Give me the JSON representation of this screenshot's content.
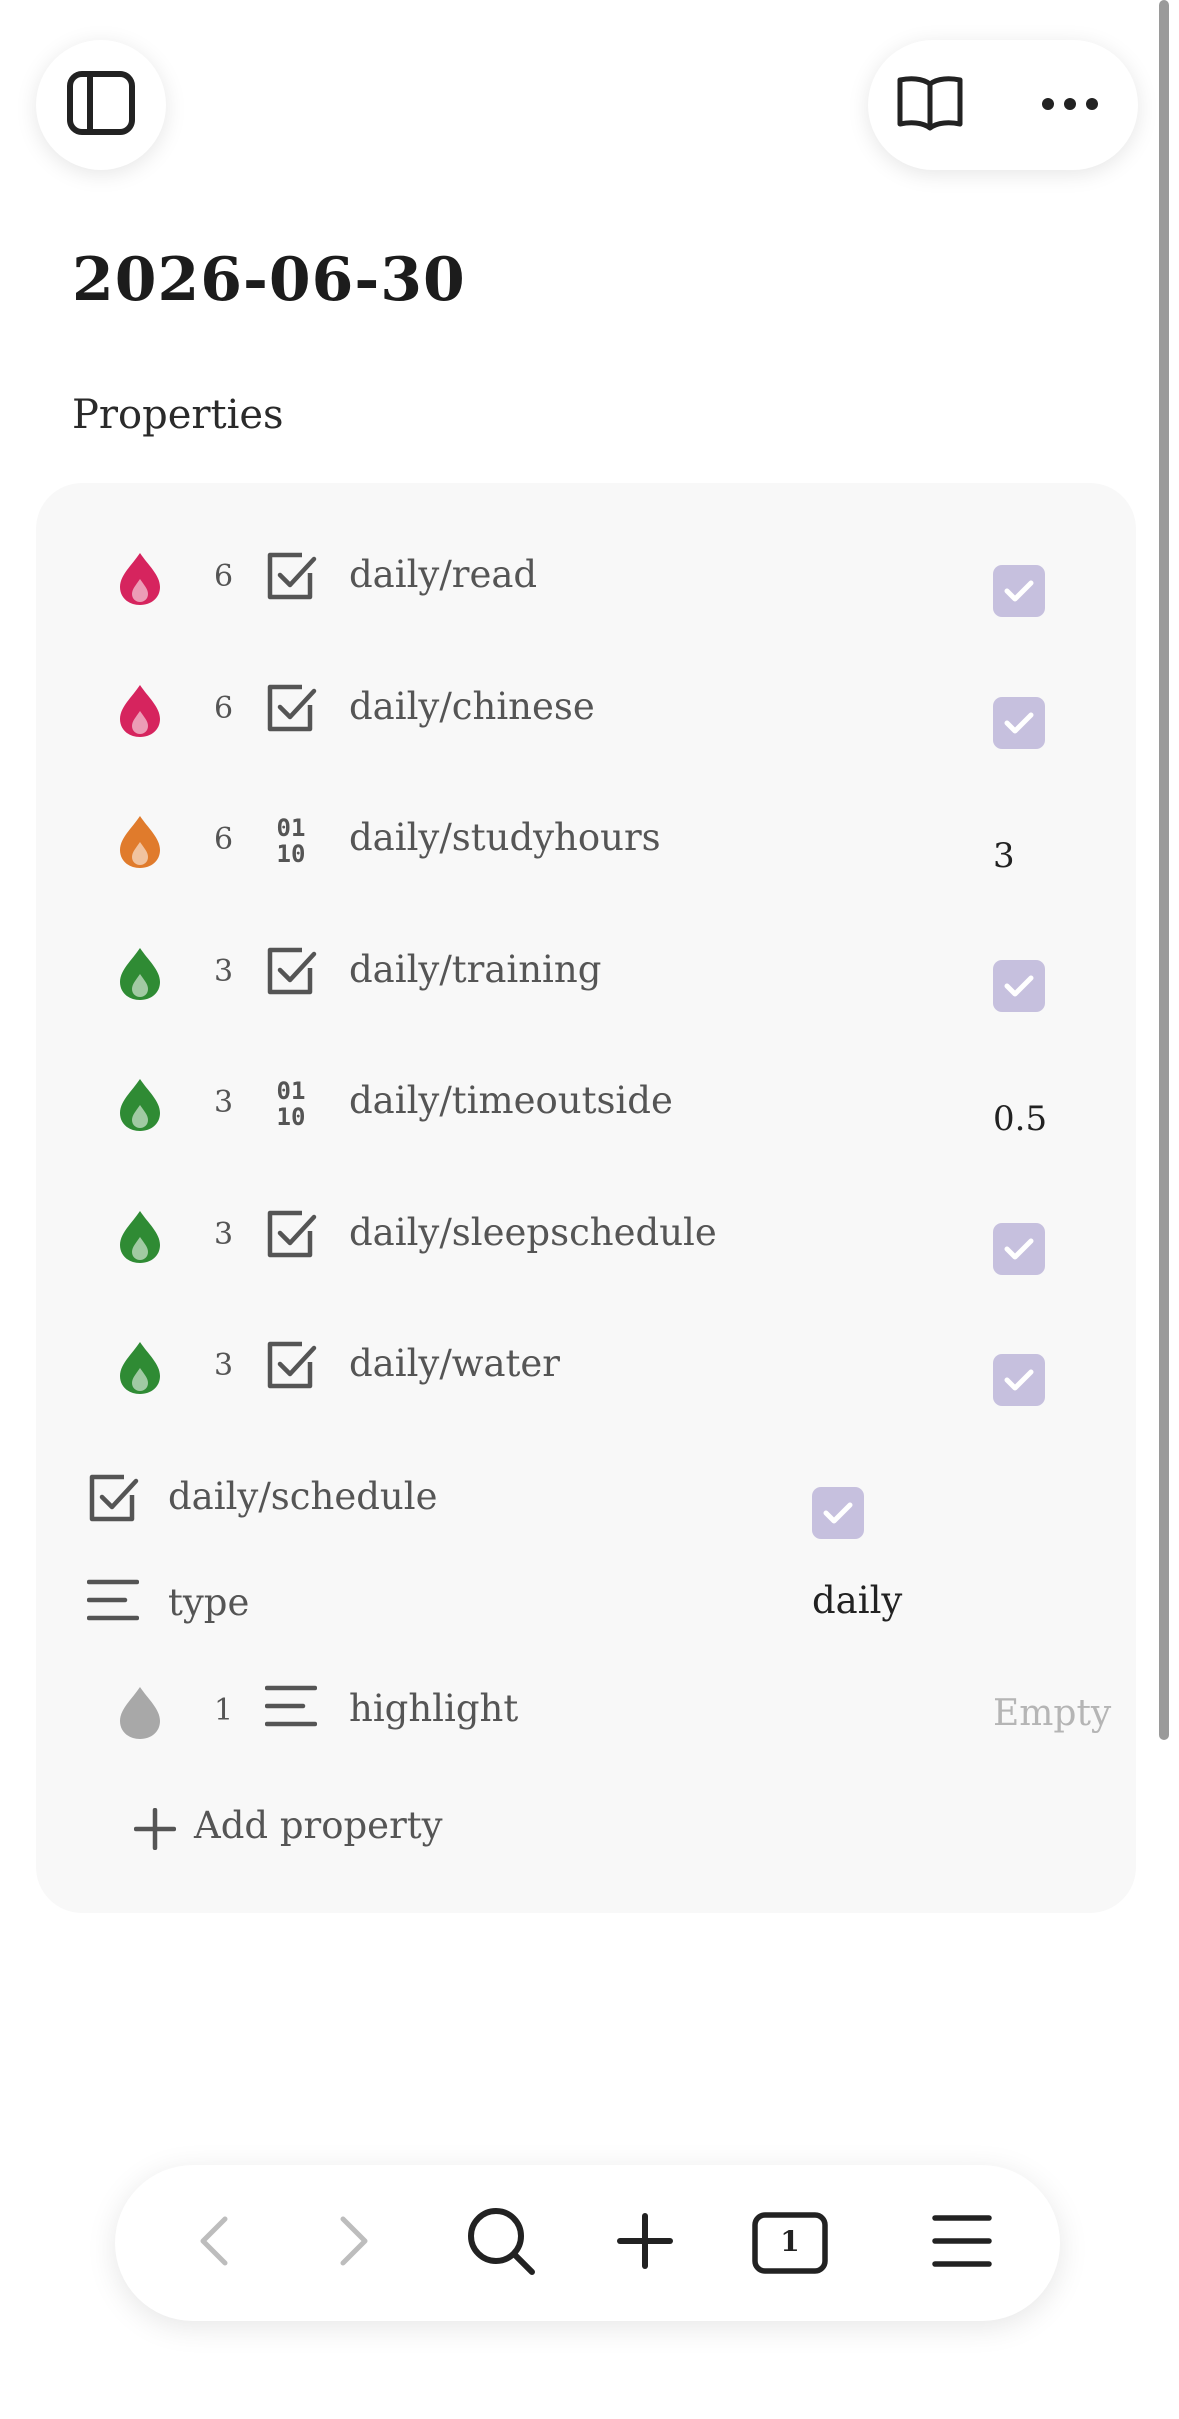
{
  "page": {
    "title": "2026-06-30",
    "properties_heading": "Properties"
  },
  "toolbar": {
    "left_icon": "sidebar-toggle-icon",
    "right_icons": [
      "book-open-icon",
      "more-horizontal-icon"
    ]
  },
  "properties": [
    {
      "name": "daily/read",
      "count": "6",
      "type": "checkbox",
      "value": true,
      "drop_color": "#d6245e"
    },
    {
      "name": "daily/chinese",
      "count": "6",
      "type": "checkbox",
      "value": true,
      "drop_color": "#d6245e"
    },
    {
      "name": "daily/studyhours",
      "count": "6",
      "type": "number",
      "value": "3",
      "drop_color": "#e07b2c"
    },
    {
      "name": "daily/training",
      "count": "3",
      "type": "checkbox",
      "value": true,
      "drop_color": "#2f8b34"
    },
    {
      "name": "daily/timeoutside",
      "count": "3",
      "type": "number",
      "value": "0.5",
      "drop_color": "#2f8b34"
    },
    {
      "name": "daily/sleepschedule",
      "count": "3",
      "type": "checkbox",
      "value": true,
      "drop_color": "#2f8b34"
    },
    {
      "name": "daily/water",
      "count": "3",
      "type": "checkbox",
      "value": true,
      "drop_color": "#2f8b34"
    }
  ],
  "simple_properties": [
    {
      "name": "daily/schedule",
      "type": "checkbox",
      "value": true
    },
    {
      "name": "type",
      "type": "text",
      "value": "daily"
    }
  ],
  "highlight_property": {
    "name": "highlight",
    "count": "1",
    "type": "text",
    "value": "Empty",
    "drop_color": "#a8a8a8"
  },
  "add_property_label": "Add property",
  "bottom_nav": {
    "icons": [
      "back-icon",
      "forward-icon",
      "search-icon",
      "new-tab-icon",
      "tabs-icon",
      "menu-icon"
    ],
    "tab_count": "1"
  },
  "colors": {
    "checkbox_fill": "#c6c0de",
    "panel_bg": "#f8f8f8"
  }
}
